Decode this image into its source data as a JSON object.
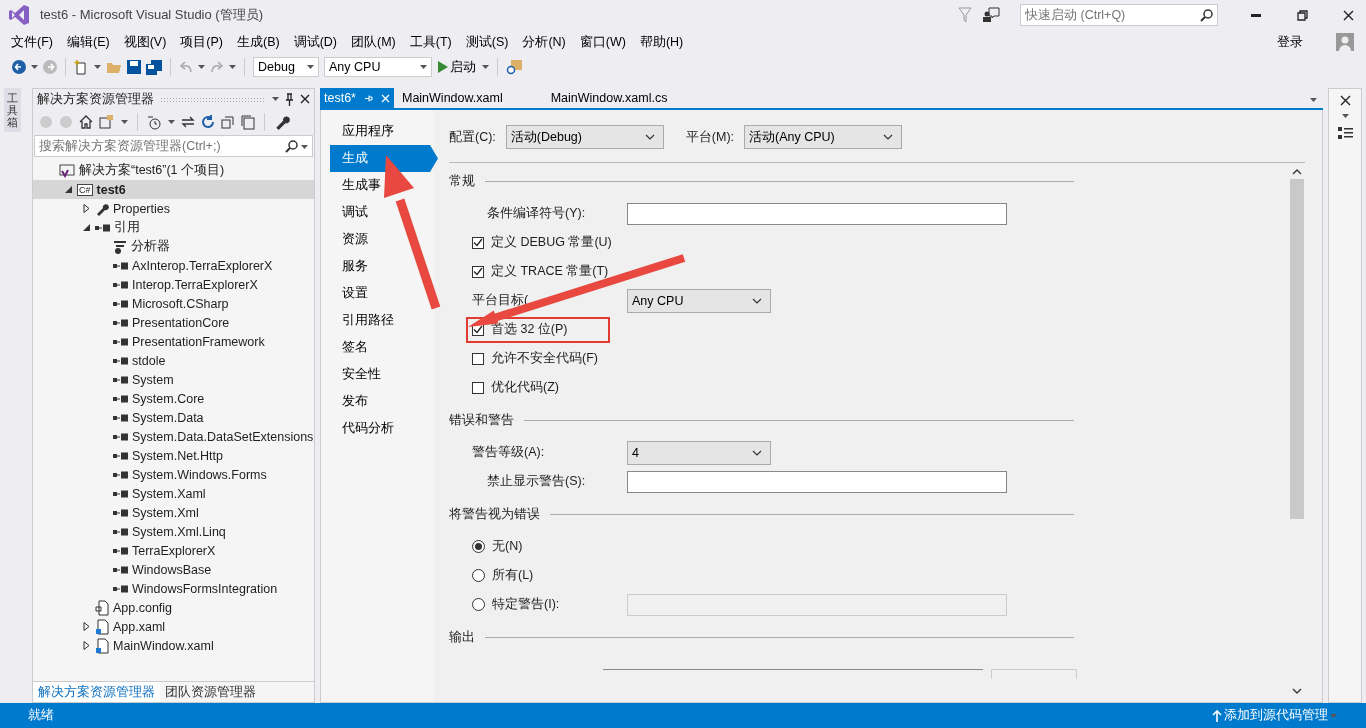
{
  "window": {
    "title": "test6 - Microsoft Visual Studio (管理员)"
  },
  "quick_launch": {
    "placeholder": "快速启动 (Ctrl+Q)"
  },
  "menu": [
    "文件(F)",
    "编辑(E)",
    "视图(V)",
    "项目(P)",
    "生成(B)",
    "调试(D)",
    "团队(M)",
    "工具(T)",
    "测试(S)",
    "分析(N)",
    "窗口(W)",
    "帮助(H)"
  ],
  "account": {
    "sign_in": "登录"
  },
  "toolbar": {
    "configuration": "Debug",
    "platform": "Any CPU",
    "start": "启动"
  },
  "toolbox_tab": "工具箱",
  "solution_explorer": {
    "title": "解决方案资源管理器",
    "search": {
      "placeholder": "搜索解决方案资源管理器(Ctrl+;)"
    },
    "tree": [
      {
        "label": "解决方案“test6”(1 个项目)",
        "kind": "solution",
        "selected": false,
        "children": [
          {
            "label": "test6",
            "kind": "project",
            "badge": "C#",
            "expanded": true,
            "selected": true,
            "children": [
              {
                "label": "Properties",
                "kind": "properties",
                "expanded": false,
                "selected": false
              },
              {
                "label": "引用",
                "kind": "references",
                "expanded": true,
                "selected": false,
                "children": [
                  {
                    "label": "分析器",
                    "kind": "analyzer",
                    "selected": false
                  },
                  {
                    "label": "AxInterop.TerraExplorerX",
                    "kind": "assembly",
                    "selected": false
                  },
                  {
                    "label": "Interop.TerraExplorerX",
                    "kind": "assembly",
                    "selected": false
                  },
                  {
                    "label": "Microsoft.CSharp",
                    "kind": "assembly",
                    "selected": false
                  },
                  {
                    "label": "PresentationCore",
                    "kind": "assembly",
                    "selected": false
                  },
                  {
                    "label": "PresentationFramework",
                    "kind": "assembly",
                    "selected": false
                  },
                  {
                    "label": "stdole",
                    "kind": "assembly",
                    "selected": false
                  },
                  {
                    "label": "System",
                    "kind": "assembly",
                    "selected": false
                  },
                  {
                    "label": "System.Core",
                    "kind": "assembly",
                    "selected": false
                  },
                  {
                    "label": "System.Data",
                    "kind": "assembly",
                    "selected": false
                  },
                  {
                    "label": "System.Data.DataSetExtensions",
                    "kind": "assembly",
                    "selected": false
                  },
                  {
                    "label": "System.Net.Http",
                    "kind": "assembly",
                    "selected": false
                  },
                  {
                    "label": "System.Windows.Forms",
                    "kind": "assembly",
                    "selected": false
                  },
                  {
                    "label": "System.Xaml",
                    "kind": "assembly",
                    "selected": false
                  },
                  {
                    "label": "System.Xml",
                    "kind": "assembly",
                    "selected": false
                  },
                  {
                    "label": "System.Xml.Linq",
                    "kind": "assembly",
                    "selected": false
                  },
                  {
                    "label": "TerraExplorerX",
                    "kind": "assembly",
                    "selected": false
                  },
                  {
                    "label": "WindowsBase",
                    "kind": "assembly",
                    "selected": false
                  },
                  {
                    "label": "WindowsFormsIntegration",
                    "kind": "assembly",
                    "selected": false
                  }
                ]
              },
              {
                "label": "App.config",
                "kind": "config",
                "selected": false
              },
              {
                "label": "App.xaml",
                "kind": "xaml",
                "expanded": false,
                "selected": false
              },
              {
                "label": "MainWindow.xaml",
                "kind": "xaml",
                "expanded": false,
                "selected": false
              }
            ]
          }
        ]
      }
    ],
    "bottom_tabs": [
      {
        "label": "解决方案资源管理器",
        "selected": true
      },
      {
        "label": "团队资源管理器",
        "selected": false
      }
    ]
  },
  "document_tabs": [
    {
      "label": "test6*",
      "selected": true
    },
    {
      "label": "MainWindow.xaml",
      "selected": false
    },
    {
      "label": "MainWindow.xaml.cs",
      "selected": false
    }
  ],
  "project_nav": [
    {
      "label": "应用程序",
      "selected": false
    },
    {
      "label": "生成",
      "selected": true
    },
    {
      "label": "生成事",
      "selected": false
    },
    {
      "label": "调试",
      "selected": false
    },
    {
      "label": "资源",
      "selected": false
    },
    {
      "label": "服务",
      "selected": false
    },
    {
      "label": "设置",
      "selected": false
    },
    {
      "label": "引用路径",
      "selected": false
    },
    {
      "label": "签名",
      "selected": false
    },
    {
      "label": "安全性",
      "selected": false
    },
    {
      "label": "发布",
      "selected": false
    },
    {
      "label": "代码分析",
      "selected": false
    }
  ],
  "build_page": {
    "configuration_label": "配置(C):",
    "configuration": "活动(Debug)",
    "platform_label": "平台(M):",
    "platform": "活动(Any CPU)",
    "sections": [
      {
        "title": "常规",
        "rows": [
          {
            "kind": "text",
            "label": "条件编译符号(Y):"
          },
          {
            "kind": "checkbox",
            "label": "定义 DEBUG 常量(U)",
            "checked": true
          },
          {
            "kind": "checkbox",
            "label": "定义 TRACE 常量(T)",
            "checked": true
          },
          {
            "kind": "select",
            "label": "平台目标(",
            "value": "Any CPU"
          },
          {
            "kind": "checkbox",
            "label": "首选 32 位(P)",
            "checked": true,
            "highlighted": true
          },
          {
            "kind": "checkbox",
            "label": "允许不安全代码(F)",
            "checked": false
          },
          {
            "kind": "checkbox",
            "label": "优化代码(Z)",
            "checked": false
          }
        ]
      },
      {
        "title": "错误和警告",
        "rows": [
          {
            "kind": "select",
            "label": "警告等级(A):",
            "value": "4"
          },
          {
            "kind": "text",
            "label": "禁止显示警告(S):"
          }
        ]
      },
      {
        "title": "将警告视为错误",
        "rows": [
          {
            "kind": "radio",
            "label": "无(N)",
            "selected": true
          },
          {
            "kind": "radio",
            "label": "所有(L)",
            "selected": false
          },
          {
            "kind": "radio",
            "label": "特定警告(I):",
            "selected": false,
            "disabled_field": true
          }
        ]
      },
      {
        "title": "输出",
        "kind": "cut"
      }
    ]
  },
  "status_bar": {
    "text": "就绪",
    "source_control": "添加到源代码管理"
  }
}
